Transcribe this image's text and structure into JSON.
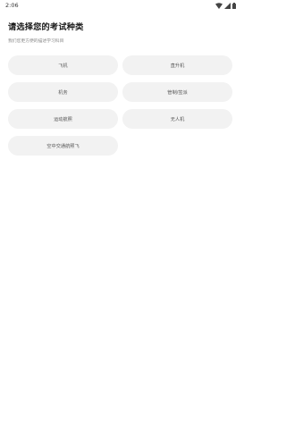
{
  "status_bar": {
    "time": "2:06",
    "icons": [
      "wifi-icon",
      "signal-icon",
      "battery-icon"
    ]
  },
  "header": {
    "title": "请选择您的考试种类",
    "subtitle": "我们您更方便的描述学习科目"
  },
  "options": [
    {
      "label": "飞机"
    },
    {
      "label": "直升机"
    },
    {
      "label": "机务"
    },
    {
      "label": "管制/签派"
    },
    {
      "label": "运动航照"
    },
    {
      "label": "无人机"
    },
    {
      "label": "空中交通航照飞"
    }
  ],
  "colors": {
    "option_bg": "#f2f2f2",
    "option_text": "#555555",
    "title": "#1a1a1a",
    "subtitle": "#8a8a8a"
  }
}
